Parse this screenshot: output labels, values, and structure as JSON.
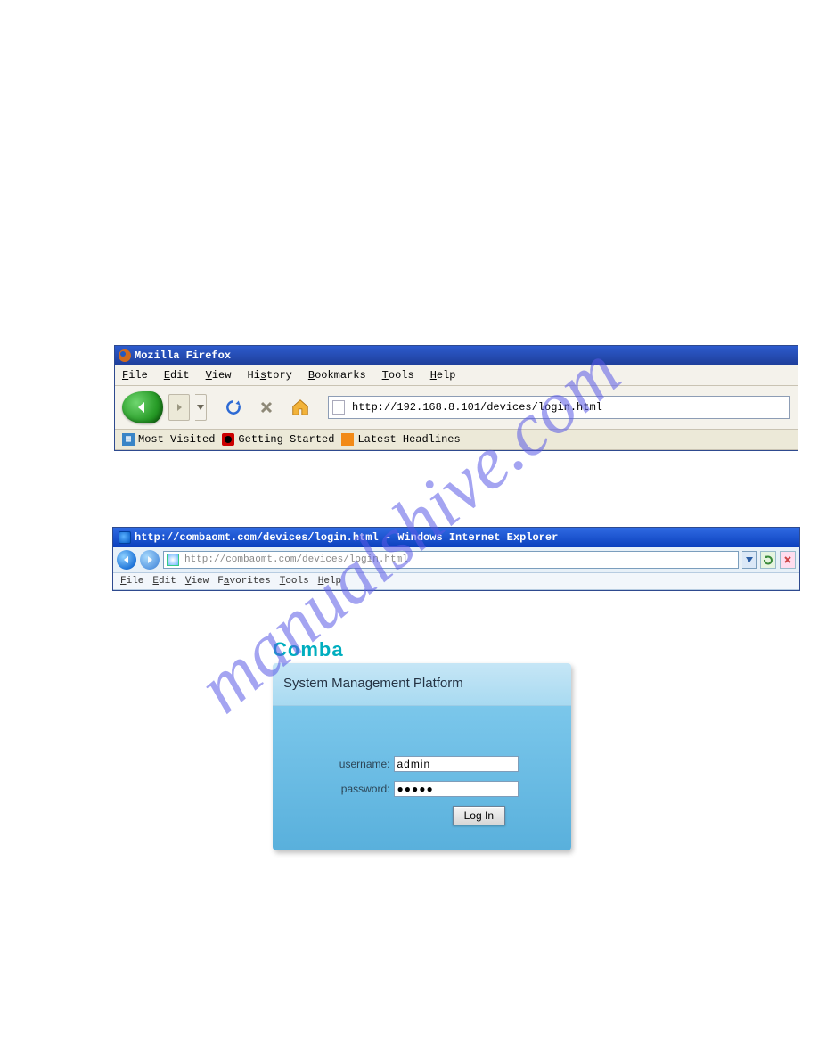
{
  "watermark": "manualshive.com",
  "intro_fragment": "                                   ",
  "firefox": {
    "title": "Mozilla Firefox",
    "menu": {
      "file": "File",
      "edit": "Edit",
      "view": "View",
      "history": "History",
      "bookmarks": "Bookmarks",
      "tools": "Tools",
      "help": "Help"
    },
    "address": "http://192.168.8.101/devices/login.html",
    "bookmarks_bar": {
      "most_visited": "Most Visited",
      "getting_started": "Getting Started",
      "latest_headlines": "Latest Headlines"
    }
  },
  "mid_link": "                         ",
  "ie": {
    "title": "http://combaomt.com/devices/login.html - Windows Internet Explorer",
    "address": "http://combaomt.com/devices/login.html",
    "menu": {
      "file": "File",
      "edit": "Edit",
      "view": "View",
      "favorites": "Favorites",
      "tools": "Tools",
      "help": "Help"
    }
  },
  "login": {
    "brand": "Comba",
    "heading": "System Management Platform",
    "username_label": "username:",
    "username_value": "admin",
    "password_label": "password:",
    "password_value": "●●●●●",
    "button": "Log In"
  }
}
